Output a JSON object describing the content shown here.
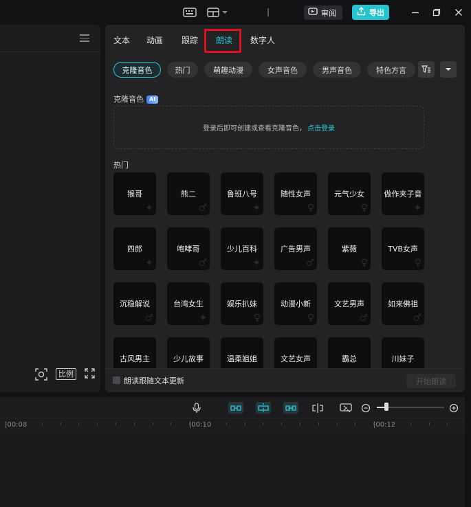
{
  "titlebar": {
    "review_label": "审阅",
    "export_label": "导出",
    "icons": [
      "keyboard-icon",
      "layout-icon",
      "chevron-down-icon",
      "divider",
      "review-icon",
      "upload-icon",
      "minimize-icon",
      "maximize-icon",
      "close-icon"
    ]
  },
  "left_panel": {
    "ratio_label": "比例",
    "icons": [
      "menu-icon",
      "screenshot-icon",
      "fullscreen-icon"
    ]
  },
  "right_panel": {
    "tabs": [
      "文本",
      "动画",
      "跟踪",
      "朗读",
      "数字人"
    ],
    "active_tab": "朗读",
    "chips": [
      "克隆音色",
      "热门",
      "萌趣动漫",
      "女声音色",
      "男声音色",
      "特色方言"
    ],
    "active_chip": "克隆音色",
    "clone_section": {
      "title": "克隆音色",
      "badge": "AI",
      "prompt": "登录后即可创建或查看克隆音色，",
      "link": "点击登录"
    },
    "hot_section": {
      "title": "热门",
      "voices": [
        "猴哥",
        "熊二",
        "鲁班八号",
        "随性女声",
        "元气少女",
        "做作夹子音",
        "四郎",
        "咆哮哥",
        "少儿百科",
        "广告男声",
        "紫薇",
        "TVB女声",
        "沉稳解说",
        "台湾女生",
        "娱乐扒妹",
        "动漫小新",
        "文艺男声",
        "如来佛祖",
        "古风男主",
        "少儿故事",
        "温柔姐姐",
        "文艺女声",
        "霸总",
        "川妹子"
      ]
    },
    "footer": {
      "follow_label": "朗读跟随文本更新",
      "start_label": "开始朗读"
    }
  },
  "timeline": {
    "time_labels": [
      "|00:08",
      "|00:10",
      "|00:12"
    ],
    "zoom_level": 0.12
  }
}
